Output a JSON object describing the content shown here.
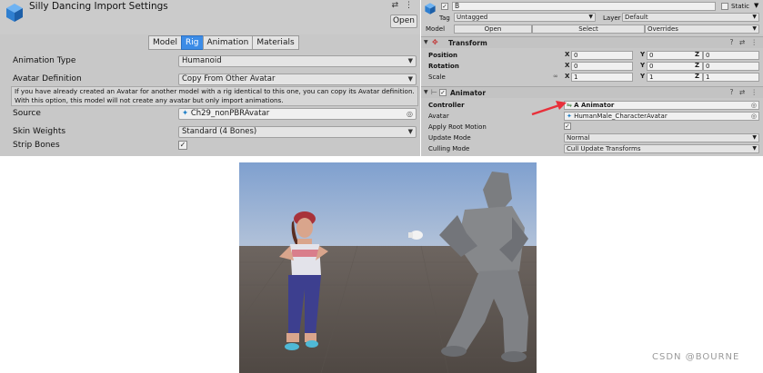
{
  "import_settings": {
    "title": "Silly Dancing Import Settings",
    "header_icons": "⇄ ⋮",
    "open_button": "Open",
    "tabs": [
      "Model",
      "Rig",
      "Animation",
      "Materials"
    ],
    "active_tab": "Rig",
    "animation_type": {
      "label": "Animation Type",
      "value": "Humanoid"
    },
    "avatar_definition": {
      "label": "Avatar Definition",
      "value": "Copy From Other Avatar"
    },
    "help_text_1": "If you have already created an Avatar for another model with a rig identical to this one, you can copy its Avatar definition.",
    "help_text_2": "With this option, this model will not create any avatar but only import animations.",
    "source": {
      "label": "Source",
      "value": "Ch29_nonPBRAvatar"
    },
    "skin_weights": {
      "label": "Skin Weights",
      "value": "Standard (4 Bones)"
    },
    "strip_bones": {
      "label": "Strip Bones",
      "checked": true
    }
  },
  "inspector": {
    "object_name": "B",
    "static_label": "Static",
    "tag_label": "Tag",
    "tag_value": "Untagged",
    "layer_label": "Layer",
    "layer_value": "Default",
    "model_label": "Model",
    "model_buttons": [
      "Open",
      "Select",
      "Overrides"
    ],
    "transform": {
      "title": "Transform",
      "rows": [
        {
          "label": "Position",
          "x": "0",
          "y": "0",
          "z": "0"
        },
        {
          "label": "Rotation",
          "x": "0",
          "y": "0",
          "z": "0"
        },
        {
          "label": "Scale",
          "x": "1",
          "y": "1",
          "z": "1"
        }
      ]
    },
    "animator": {
      "title": "Animator",
      "controller_label": "Controller",
      "controller_value": "A Animator",
      "avatar_label": "Avatar",
      "avatar_value": "HumanMale_CharacterAvatar",
      "apply_root_motion_label": "Apply Root Motion",
      "update_mode_label": "Update Mode",
      "update_mode_value": "Normal",
      "culling_mode_label": "Culling Mode",
      "culling_mode_value": "Cull Update Transforms"
    },
    "component_icons": "? ⇄ ⋮",
    "axis_labels": [
      "X",
      "Y",
      "Z"
    ]
  },
  "watermark": "CSDN @BOURNE",
  "colors": {
    "tab_active": "#3c8ce7",
    "arrow_annotation": "#e8303a",
    "panel_bg": "#c8c8c8"
  }
}
